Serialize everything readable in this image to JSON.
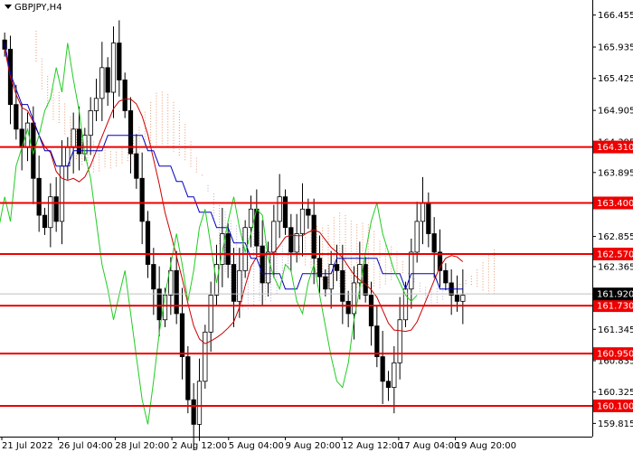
{
  "chart_data": {
    "type": "candlestick",
    "symbol_label": "GBPJPY,H4",
    "price_range": [
      159.6,
      166.7
    ],
    "x_range_dates": [
      "21 Jul 2022",
      "19 Aug 20:00"
    ],
    "y_ticks": [
      166.455,
      165.935,
      165.425,
      164.905,
      164.395,
      163.895,
      163.365,
      162.855,
      162.365,
      161.92,
      161.345,
      160.835,
      160.325,
      159.815
    ],
    "x_ticks": [
      "21 Jul 2022",
      "26 Jul 04:00",
      "28 Jul 20:00",
      "2 Aug 12:00",
      "5 Aug 04:00",
      "9 Aug 20:00",
      "12 Aug 12:00",
      "17 Aug 04:00",
      "19 Aug 20:00"
    ],
    "levels": [
      {
        "price": 164.31,
        "label": "164.310"
      },
      {
        "price": 163.4,
        "label": "163.400"
      },
      {
        "price": 162.57,
        "label": "162.570"
      },
      {
        "price": 161.73,
        "label": "161.730"
      },
      {
        "price": 160.95,
        "label": "160.950"
      },
      {
        "price": 160.1,
        "label": "160.100"
      }
    ],
    "current_price": {
      "price": 161.92,
      "label": "161.920"
    },
    "close_series": [
      165.9,
      165.0,
      164.6,
      164.3,
      164.7,
      163.8,
      163.2,
      163.0,
      163.5,
      163.1,
      164.0,
      164.3,
      164.6,
      164.2,
      164.5,
      164.9,
      165.1,
      165.6,
      165.2,
      166.0,
      165.4,
      164.9,
      164.2,
      163.8,
      163.1,
      162.4,
      162.0,
      161.5,
      161.9,
      162.3,
      161.6,
      160.9,
      160.2,
      159.8,
      160.5,
      161.3,
      161.9,
      162.4,
      162.9,
      162.4,
      161.8,
      162.3,
      163.0,
      163.3,
      162.7,
      162.1,
      162.6,
      163.1,
      163.5,
      163.0,
      162.6,
      162.9,
      163.3,
      163.2,
      162.5,
      162.2,
      162.0,
      162.4,
      162.3,
      161.8,
      161.6,
      162.1,
      162.4,
      161.9,
      161.4,
      160.9,
      160.5,
      160.4,
      160.8,
      161.5,
      162.0,
      162.6,
      163.1,
      163.4,
      162.9,
      162.6,
      162.3,
      162.1,
      161.9,
      161.8,
      161.9
    ],
    "series": [
      {
        "name": "price",
        "color": "#000000"
      },
      {
        "name": "tenkan",
        "color": "#cc0000"
      },
      {
        "name": "kijun",
        "color": "#0000bb"
      },
      {
        "name": "chikou",
        "color": "#22cc22"
      },
      {
        "name": "senkou_a",
        "color": "#e8956b"
      },
      {
        "name": "senkou_b",
        "color": "#b8a8d8"
      }
    ],
    "level_color": "#ee0000",
    "current_price_color": "#000000"
  }
}
